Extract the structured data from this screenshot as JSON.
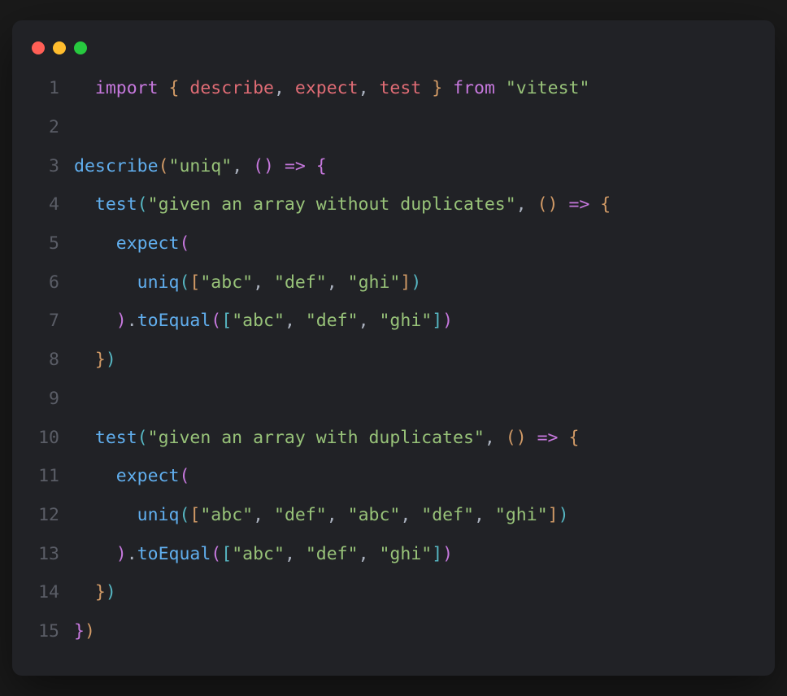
{
  "titlebar": {
    "red": "close",
    "yellow": "minimize",
    "green": "maximize"
  },
  "code": {
    "lines": [
      {
        "n": "1"
      },
      {
        "n": "2"
      },
      {
        "n": "3"
      },
      {
        "n": "4"
      },
      {
        "n": "5"
      },
      {
        "n": "6"
      },
      {
        "n": "7"
      },
      {
        "n": "8"
      },
      {
        "n": "9"
      },
      {
        "n": "10"
      },
      {
        "n": "11"
      },
      {
        "n": "12"
      },
      {
        "n": "13"
      },
      {
        "n": "14"
      },
      {
        "n": "15"
      }
    ],
    "tokens": {
      "import": "import",
      "from": "from",
      "describe": "describe",
      "expect": "expect",
      "test": "test",
      "vitest": "\"vitest\"",
      "uniq": "uniq",
      "toEqual": "toEqual",
      "str_uniq": "\"uniq\"",
      "str_test1": "\"given an array without duplicates\"",
      "str_test2": "\"given an array with duplicates\"",
      "str_abc": "\"abc\"",
      "str_def": "\"def\"",
      "str_ghi": "\"ghi\"",
      "arrow": "=>",
      "lbrace": "{",
      "rbrace": "}",
      "lparen": "(",
      "rparen": ")",
      "lbracket": "[",
      "rbracket": "]",
      "comma": ",",
      "dot": ".",
      "space": " "
    }
  }
}
